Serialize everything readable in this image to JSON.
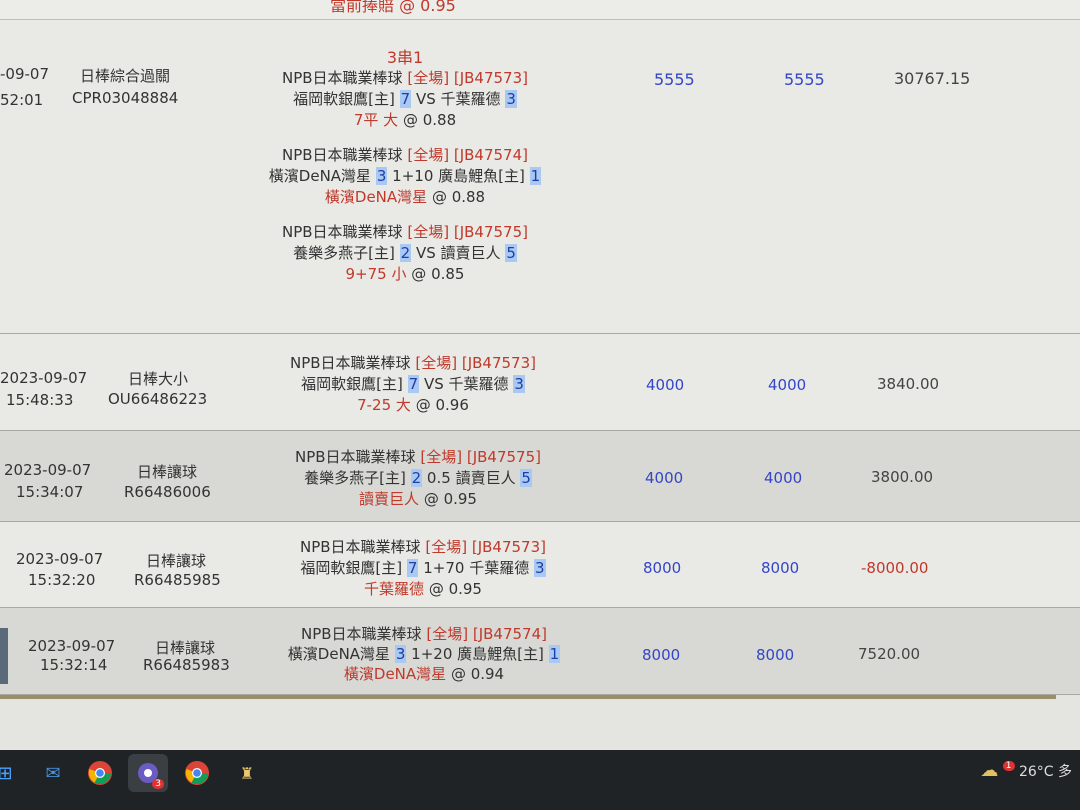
{
  "top_cut_text": "當前捧賠 @ 0.95",
  "rows": [
    {
      "date": "-09-07",
      "time": "52:01",
      "type": "日棒綜合過關",
      "ticket": "CPR03048884",
      "mix_label": "3串1",
      "legs": [
        {
          "league": "NPB日本職業棒球",
          "scope": "[全場]",
          "code": "[JB47573]",
          "home": "福岡軟銀鷹[主]",
          "home_score": "7",
          "vs": "VS",
          "away": "千葉羅德",
          "away_score": "3",
          "bet_line": "7平",
          "bet_pick": "大",
          "odds": "@ 0.88"
        },
        {
          "league": "NPB日本職業棒球",
          "scope": "[全場]",
          "code": "[JB47574]",
          "home": "橫濱DeNA灣星",
          "home_score": "3",
          "vs": "1+10",
          "away": "廣島鯉魚[主]",
          "away_score": "1",
          "bet_line": "",
          "bet_pick": "橫濱DeNA灣星",
          "odds": "@ 0.88"
        },
        {
          "league": "NPB日本職業棒球",
          "scope": "[全場]",
          "code": "[JB47575]",
          "home": "養樂多燕子[主]",
          "home_score": "2",
          "vs": "VS",
          "away": "讀賣巨人",
          "away_score": "5",
          "bet_line": "9+75",
          "bet_pick": "小",
          "odds": "@ 0.85"
        }
      ],
      "stake": "5555",
      "valid": "5555",
      "result": "30767.15"
    },
    {
      "date": "2023-09-07",
      "time": "15:48:33",
      "type": "日棒大小",
      "ticket": "OU66486223",
      "league": "NPB日本職業棒球",
      "scope": "[全場]",
      "code": "[JB47573]",
      "home": "福岡軟銀鷹[主]",
      "home_score": "7",
      "vs": "VS",
      "away": "千葉羅德",
      "away_score": "3",
      "bet_line": "7-25",
      "bet_pick": "大",
      "odds": "@ 0.96",
      "stake": "4000",
      "valid": "4000",
      "result": "3840.00"
    },
    {
      "date": "2023-09-07",
      "time": "15:34:07",
      "type": "日棒讓球",
      "ticket": "R66486006",
      "league": "NPB日本職業棒球",
      "scope": "[全場]",
      "code": "[JB47575]",
      "home": "養樂多燕子[主]",
      "home_score": "2",
      "vs": "0.5",
      "away": "讀賣巨人",
      "away_score": "5",
      "bet_pick": "讀賣巨人",
      "odds": "@ 0.95",
      "stake": "4000",
      "valid": "4000",
      "result": "3800.00"
    },
    {
      "date": "2023-09-07",
      "time": "15:32:20",
      "type": "日棒讓球",
      "ticket": "R66485985",
      "league": "NPB日本職業棒球",
      "scope": "[全場]",
      "code": "[JB47573]",
      "home": "福岡軟銀鷹[主]",
      "home_score": "7",
      "vs": "1+70",
      "away": "千葉羅德",
      "away_score": "3",
      "bet_pick": "千葉羅德",
      "odds": "@ 0.95",
      "stake": "8000",
      "valid": "8000",
      "result": "-8000.00"
    },
    {
      "date": "2023-09-07",
      "time": "15:32:14",
      "type": "日棒讓球",
      "ticket": "R66485983",
      "league": "NPB日本職業棒球",
      "scope": "[全場]",
      "code": "[JB47574]",
      "home": "橫濱DeNA灣星",
      "home_score": "3",
      "vs": "1+20",
      "away": "廣島鯉魚[主]",
      "away_score": "1",
      "bet_pick": "橫濱DeNA灣星",
      "odds": "@ 0.94",
      "stake": "8000",
      "valid": "8000",
      "result": "7520.00"
    }
  ],
  "taskbar": {
    "icons": [
      "windows-icon",
      "mail-icon",
      "chrome-icon",
      "app-icon",
      "chrome-icon",
      "game-icon"
    ],
    "app_badge": "3",
    "weather_temp": "26°C",
    "weather_text": "多",
    "weather_badge": "1"
  }
}
